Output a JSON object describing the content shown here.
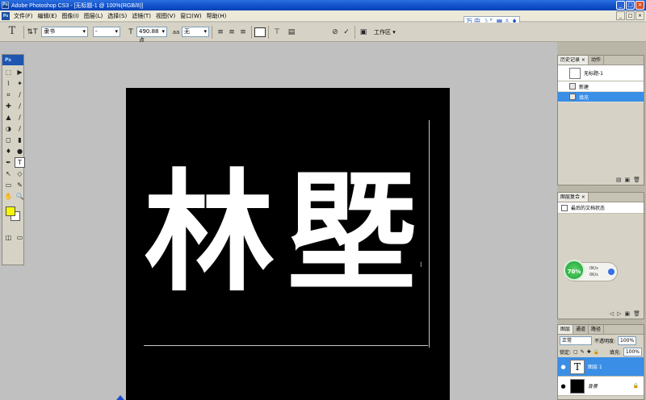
{
  "window": {
    "app_logo": "Ps",
    "title": "Adobe Photoshop CS3 - [无标题-1 @ 100%(RGB/8)]",
    "controls": [
      "_",
      "□",
      "×"
    ]
  },
  "menu": {
    "logo": "Ps",
    "items": [
      "文件(F)",
      "编辑(E)",
      "图像(I)",
      "图层(L)",
      "选择(S)",
      "滤镜(T)",
      "视图(V)",
      "窗口(W)",
      "帮助(H)"
    ],
    "mdi_controls": [
      "_",
      "□",
      "×"
    ]
  },
  "options": {
    "tool_glyph": "T",
    "orient_glyph": "⇅T",
    "font_family": "隶书",
    "font_style": "-",
    "font_size": "490.88 点",
    "aa_label": "aa",
    "aa_mode": "无",
    "align_icons": [
      "≡",
      "≡",
      "≡"
    ],
    "warp_icon": "⊤",
    "cancel_icon": "⊘",
    "commit_icon": "✓",
    "workspace_label": "工作区 ▾",
    "ime_items": [
      "万",
      "中",
      "☽",
      "°,",
      "▦",
      "♙",
      "♦"
    ]
  },
  "toolbox": {
    "header": "Ps",
    "tools": [
      "⬚",
      "▶",
      "⌇",
      "✦",
      "⌗",
      "∕",
      "✚",
      "∕",
      "▲",
      "∕",
      "◑",
      "∕",
      "◻",
      "▮",
      "♦",
      "●",
      "✒",
      "T",
      "↖",
      "◇",
      "▭",
      "✎",
      "✋",
      "🔍",
      "◫",
      "▭"
    ],
    "foreground_color": "#f7f700",
    "background_color": "#ffffff"
  },
  "canvas": {
    "text": "林塈",
    "background_color": "#000000",
    "text_color": "#ffffff"
  },
  "history_panel": {
    "tabs": [
      "历史记录 ×",
      "动作"
    ],
    "snapshot": "无标题-1",
    "items": [
      {
        "label": "新建",
        "selected": false
      },
      {
        "label": "填充",
        "selected": true
      }
    ],
    "footer_icons": [
      "▤",
      "▣",
      "🗑"
    ]
  },
  "status_panel": {
    "tabs": [
      "图层复合 ×"
    ],
    "last_state": "最后的文档状态",
    "gauge_percent": "70%",
    "gauge_rows": [
      "0K/s",
      "0K/s"
    ],
    "footer_icons": [
      "◁",
      "▷",
      "▣",
      "🗑"
    ]
  },
  "layers_panel": {
    "tabs": [
      "图层",
      "通道",
      "路径"
    ],
    "blend_mode": "正常",
    "opacity_label": "不透明度:",
    "opacity_value": "100%",
    "fill_label": "填充:",
    "fill_value": "100%",
    "lock_label": "锁定:",
    "layers": [
      {
        "name": "图层 1",
        "thumb": "T",
        "selected": true
      },
      {
        "name": "背景",
        "thumb": "",
        "selected": false
      }
    ]
  }
}
